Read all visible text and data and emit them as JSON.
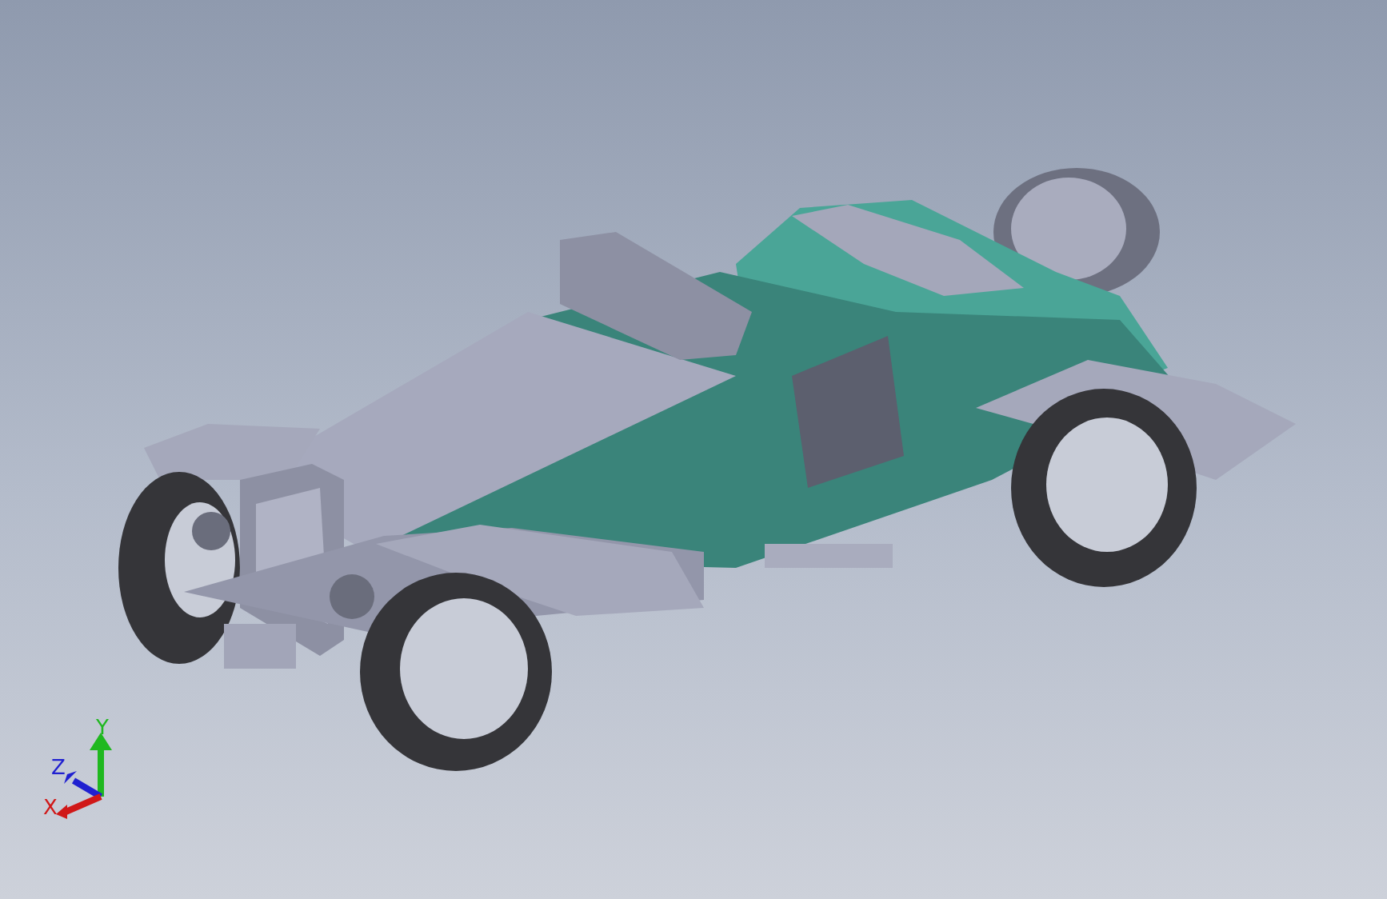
{
  "viewport": {
    "triad": {
      "axes": [
        {
          "label": "Y",
          "color": "#1fb81f"
        },
        {
          "label": "Z",
          "color": "#2020d0"
        },
        {
          "label": "X",
          "color": "#d01818"
        }
      ]
    }
  }
}
